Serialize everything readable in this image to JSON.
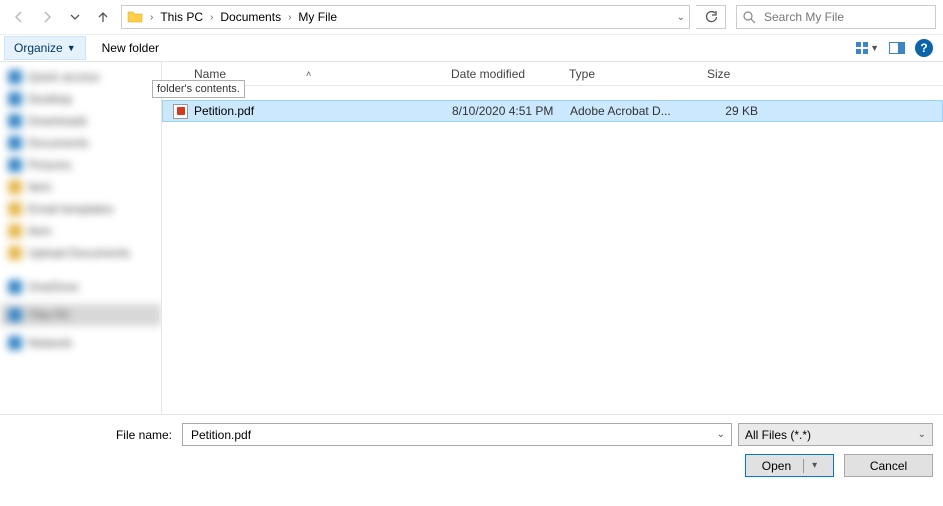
{
  "nav": {
    "breadcrumbs": [
      "This PC",
      "Documents",
      "My File"
    ]
  },
  "search": {
    "placeholder": "Search My File"
  },
  "toolbar": {
    "organize": "Organize",
    "newfolder": "New folder"
  },
  "headers": {
    "name": "Name",
    "date": "Date modified",
    "type": "Type",
    "size": "Size"
  },
  "tooltip": "folder's contents.",
  "files": [
    {
      "name": "Petition.pdf",
      "date": "8/10/2020 4:51 PM",
      "type": "Adobe Acrobat D...",
      "size": "29 KB"
    }
  ],
  "footer": {
    "filename_label": "File name:",
    "filename_value": "Petition.pdf",
    "filter": "All Files (*.*)",
    "open": "Open",
    "cancel": "Cancel"
  }
}
